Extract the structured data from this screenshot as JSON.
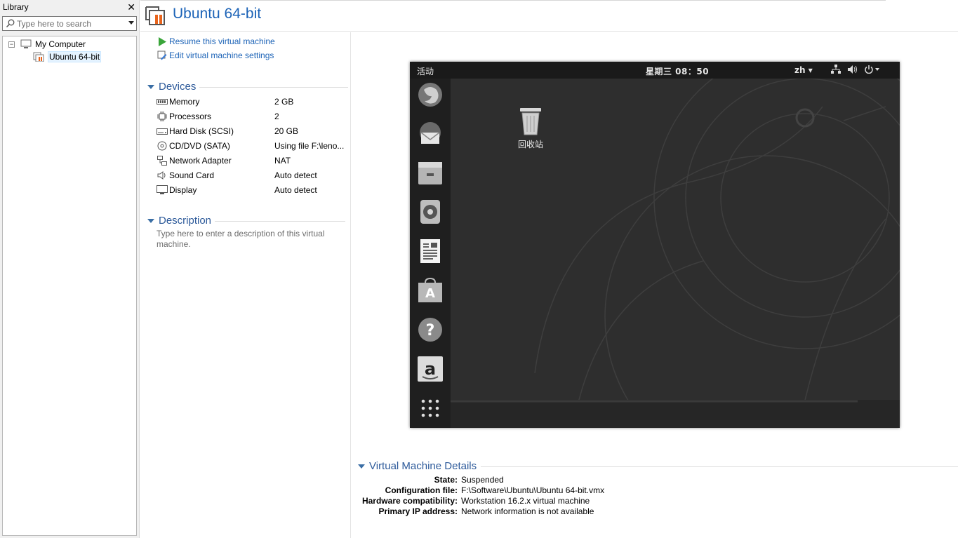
{
  "library": {
    "title": "Library",
    "close_glyph": "✕",
    "search_placeholder": "Type here to search",
    "tree": {
      "root_label": "My Computer",
      "root_toggle": "−",
      "child_label": "Ubuntu 64-bit"
    }
  },
  "header": {
    "title": "Ubuntu 64-bit"
  },
  "actions": {
    "resume": "Resume this virtual machine",
    "edit": "Edit virtual machine settings"
  },
  "devices": {
    "title": "Devices",
    "items": [
      {
        "name": "Memory",
        "value": "2 GB",
        "icon": "memory-icon"
      },
      {
        "name": "Processors",
        "value": "2",
        "icon": "processor-icon"
      },
      {
        "name": "Hard Disk (SCSI)",
        "value": "20 GB",
        "icon": "hard-disk-icon"
      },
      {
        "name": "CD/DVD (SATA)",
        "value": "Using file F:\\leno...",
        "icon": "cd-dvd-icon"
      },
      {
        "name": "Network Adapter",
        "value": "NAT",
        "icon": "network-adapter-icon"
      },
      {
        "name": "Sound Card",
        "value": "Auto detect",
        "icon": "sound-card-icon"
      },
      {
        "name": "Display",
        "value": "Auto detect",
        "icon": "display-icon"
      }
    ]
  },
  "description": {
    "title": "Description",
    "placeholder": "Type here to enter a description of this virtual machine."
  },
  "vm_screen": {
    "activities": "活动",
    "clock": "星期三 08：50",
    "language": "zh ▾",
    "trash_label": "回收站",
    "dock_icons": [
      "firefox-icon",
      "thunderbird-icon",
      "files-icon",
      "rhythmbox-icon",
      "libreoffice-writer-icon",
      "software-center-icon",
      "help-icon",
      "amazon-icon",
      "app-grid-icon"
    ],
    "tray_icons": [
      "network-icon",
      "volume-icon",
      "power-icon"
    ]
  },
  "details": {
    "title": "Virtual Machine Details",
    "rows": [
      {
        "key": "State:",
        "value": "Suspended"
      },
      {
        "key": "Configuration file:",
        "value": "F:\\Software\\Ubuntu\\Ubuntu 64-bit.vmx"
      },
      {
        "key": "Hardware compatibility:",
        "value": "Workstation 16.2.x virtual machine"
      },
      {
        "key": "Primary IP address:",
        "value": "Network information is not available"
      }
    ]
  },
  "colors": {
    "link": "#1c63b7",
    "section": "#2d5a9a",
    "accent_orange": "#e8641c",
    "play_green": "#3aa53a"
  }
}
